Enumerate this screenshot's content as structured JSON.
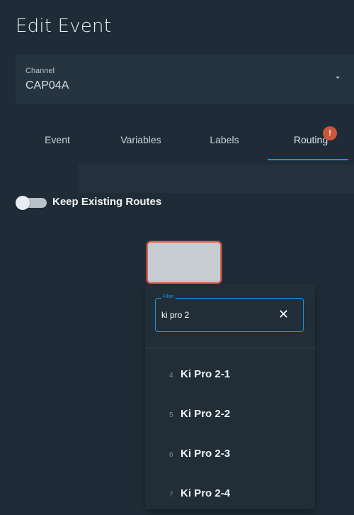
{
  "title": "Edit Event",
  "channel": {
    "label": "Channel",
    "value": "CAP04A"
  },
  "tabs": [
    {
      "label": "Event"
    },
    {
      "label": "Variables"
    },
    {
      "label": "Labels"
    },
    {
      "label": "Routing",
      "badge": "!"
    }
  ],
  "toggle": {
    "label": "Keep Existing Routes",
    "on": false
  },
  "filter": {
    "label": "Filter",
    "value": "ki pro 2",
    "clear": "✕"
  },
  "items": [
    {
      "num": "4",
      "name": "Ki Pro 2-1"
    },
    {
      "num": "5",
      "name": "Ki Pro 2-2"
    },
    {
      "num": "6",
      "name": "Ki Pro 2-3"
    },
    {
      "num": "7",
      "name": "Ki Pro 2-4"
    }
  ],
  "colors": {
    "accent": "#1d95d8",
    "badge": "#c9573b",
    "route_border": "#e0614b",
    "background": "#1f2c37"
  }
}
